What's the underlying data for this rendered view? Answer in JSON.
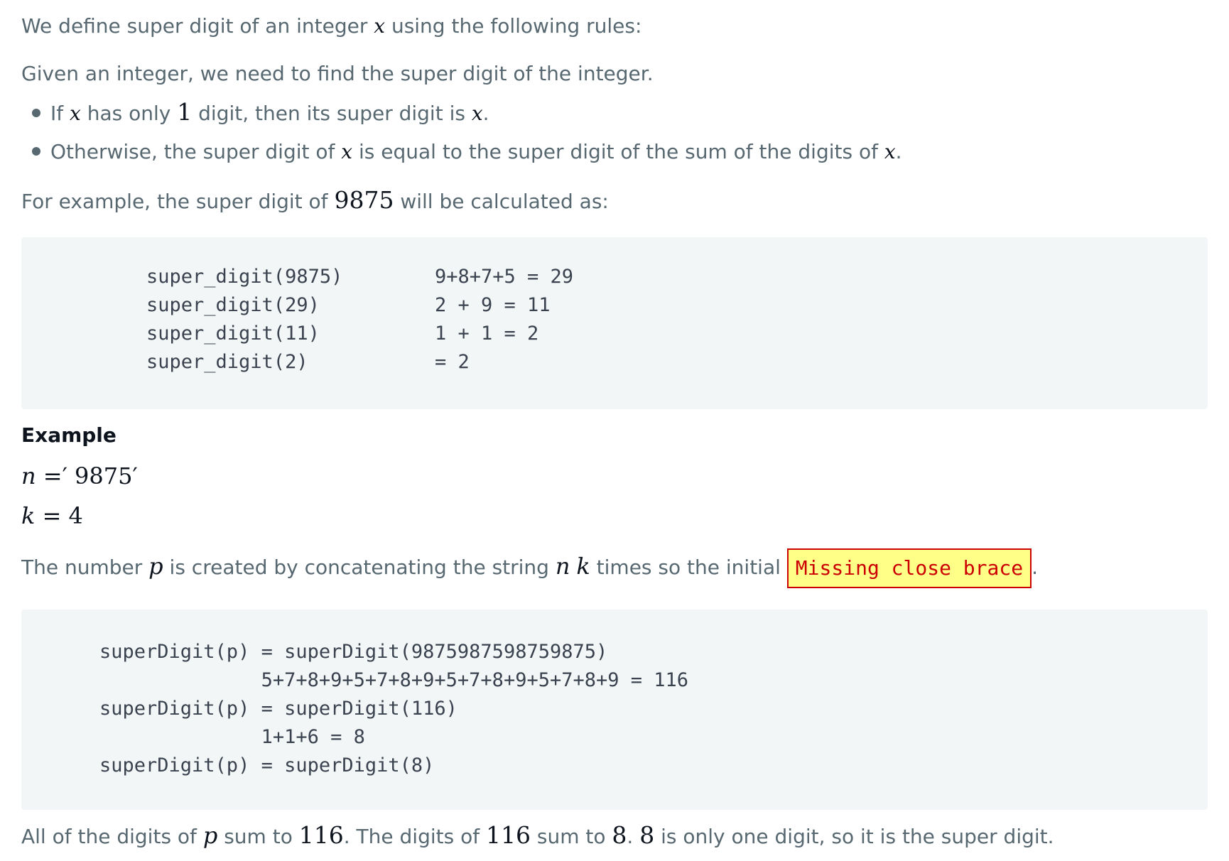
{
  "intro": {
    "line1_pre": "We define super digit of an integer ",
    "line1_var": "x",
    "line1_post": " using the following rules:",
    "line2": "Given an integer, we need to find the super digit of the integer."
  },
  "rules": [
    {
      "pre": "If ",
      "var1": "x",
      "mid1": " has only ",
      "num": "1",
      "mid2": " digit, then its super digit is ",
      "var2": "x",
      "post": "."
    },
    {
      "pre": "Otherwise, the super digit of ",
      "var1": "x",
      "mid1": " is equal to the super digit of the sum of the digits of ",
      "var2": "x",
      "post": "."
    }
  ],
  "example_intro": {
    "pre": "For example, the super digit of ",
    "num": "9875",
    "post": " will be calculated as:"
  },
  "code1": {
    "left": [
      "super_digit(9875)",
      "super_digit(29)",
      "super_digit(11)",
      "super_digit(2)"
    ],
    "right": [
      "9+8+7+5 = 29",
      "2 + 9 = 11",
      "1 + 1 = 2",
      "= 2"
    ]
  },
  "example_heading": "Example",
  "assign_n": {
    "var": "n",
    "eq": " =′ ",
    "val": "9875",
    "close": "′"
  },
  "assign_k": {
    "var": "k",
    "eq": " = ",
    "val": "4"
  },
  "concat_line": {
    "pre": "The number ",
    "var_p": "p",
    "mid": " is created by concatenating the string ",
    "var_n": "n",
    "var_k": "k",
    "post": " times so the initial ",
    "error": "Missing close brace",
    "end": "."
  },
  "code2": {
    "lines": [
      "superDigit(p) = superDigit(9875987598759875)",
      "              5+7+8+9+5+7+8+9+5+7+8+9+5+7+8+9 = 116",
      "superDigit(p) = superDigit(116)",
      "              1+1+6 = 8",
      "superDigit(p) = superDigit(8)"
    ]
  },
  "conclusion": {
    "pre": "All of the digits of ",
    "var_p": "p",
    "mid1": " sum to ",
    "num1": "116",
    "mid2": ". The digits of ",
    "num2": "116",
    "mid3": " sum to ",
    "num3": "8",
    "mid4": ". ",
    "num4": "8",
    "post": " is only one digit, so it is the super digit."
  }
}
